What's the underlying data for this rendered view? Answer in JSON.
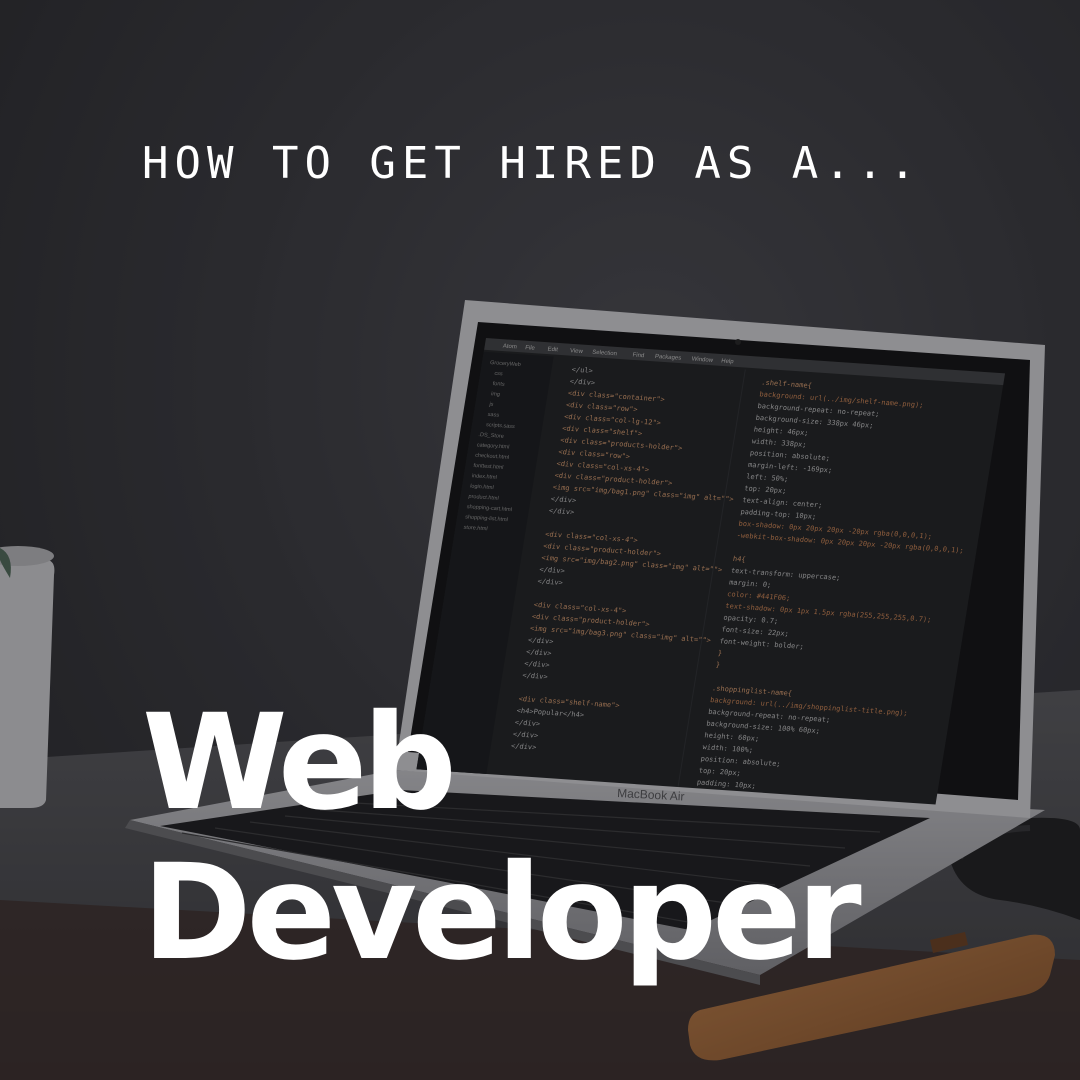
{
  "headline": "HOW TO GET HIRED AS A...",
  "title": {
    "line1": "Web",
    "line2": "Developer"
  },
  "laptop": {
    "brand_label": "MacBook Air"
  },
  "editor": {
    "menu": [
      "Atom",
      "File",
      "Edit",
      "View",
      "Selection",
      "Find",
      "Packages",
      "Window",
      "Help"
    ],
    "file_tree": [
      "GroceryWeb",
      "css",
      "fonts",
      "img",
      "js",
      "sass",
      "scripts.sass",
      ".DS_Store",
      "category.html",
      "checkout.html",
      "fonttest.html",
      "index.html",
      "login.html",
      "product.html",
      "shopping-cart.html",
      "shopping-list.html",
      "store.html"
    ],
    "html_code": [
      "</ul>",
      "</div>",
      "<div class=\"container\">",
      "  <div class=\"row\">",
      "    <div class=\"col-lg-12\">",
      "      <div class=\"shelf\">",
      "        <div class=\"products-holder\">",
      "          <div class=\"row\">",
      "            <div class=\"col-xs-4\">",
      "              <div class=\"product-holder\">",
      "                <img src=\"img/bag1.png\" class=\"img\" alt=\"\">",
      "              </div>",
      "            </div>",
      "",
      "            <div class=\"col-xs-4\">",
      "              <div class=\"product-holder\">",
      "                <img src=\"img/bag2.png\" class=\"img\" alt=\"\">",
      "              </div>",
      "            </div>",
      "",
      "            <div class=\"col-xs-4\">",
      "              <div class=\"product-holder\">",
      "                <img src=\"img/bag3.png\" class=\"img\" alt=\"\">",
      "              </div>",
      "            </div>",
      "          </div>",
      "        </div>",
      "",
      "        <div class=\"shelf-name\">",
      "          <h4>Popular</h4>",
      "        </div>",
      "      </div>",
      "    </div>"
    ],
    "css_code": [
      ".shelf-name{",
      "  background: url(../img/shelf-name.png);",
      "  background-repeat: no-repeat;",
      "  background-size: 338px 46px;",
      "  height: 46px;",
      "  width: 338px;",
      "  position: absolute;",
      "  margin-left: -169px;",
      "  left: 50%;",
      "  top: 20px;",
      "  text-align: center;",
      "  padding-top: 10px;",
      "  box-shadow: 0px 20px 20px -20px rgba(0,0,0,1);",
      "  -webkit-box-shadow: 0px 20px 20px -20px rgba(0,0,0,1);",
      "",
      "  h4{",
      "    text-transform: uppercase;",
      "    margin: 0;",
      "    color: #441F06;",
      "    text-shadow: 0px 1px 1.5px rgba(255,255,255,0.7);",
      "    opacity: 0.7;",
      "    font-size: 22px;",
      "    font-weight: bolder;",
      "  }",
      "}",
      "",
      ".shoppinglist-name{",
      "  background: url(../img/shoppinglist-title.png);",
      "  background-repeat: no-repeat;",
      "  background-size: 100% 60px;",
      "  height: 60px;",
      "  width: 100%;",
      "  position: absolute;",
      "  top: 20px;",
      "  padding: 10px;"
    ]
  }
}
